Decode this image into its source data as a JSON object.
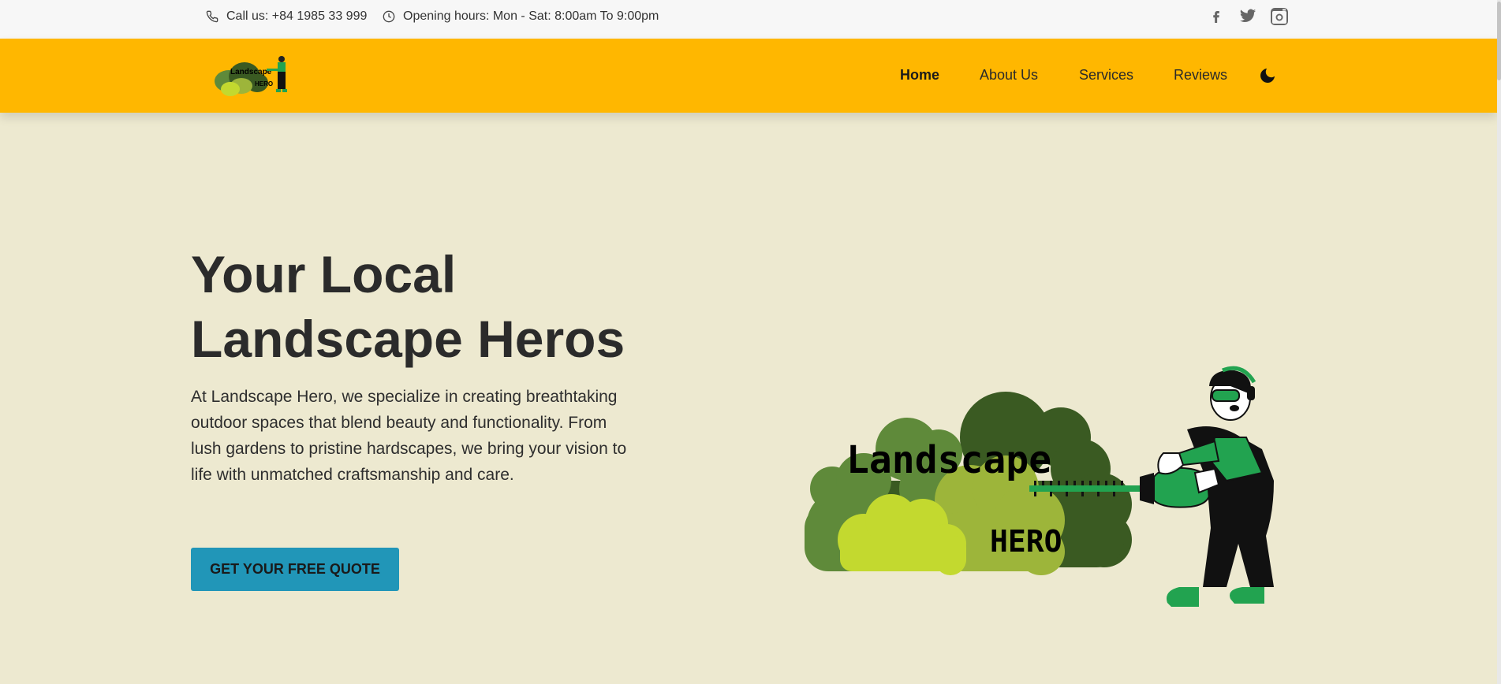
{
  "topbar": {
    "phone_text": "Call us: +84 1985 33 999",
    "hours_text": "Opening hours: Mon - Sat: 8:00am To 9:00pm",
    "social": [
      "facebook-icon",
      "twitter-icon",
      "instagram-icon"
    ]
  },
  "brand": {
    "logo_line1": "Landscape",
    "logo_line2": "HERO"
  },
  "nav": {
    "home": "Home",
    "about": "About Us",
    "services": "Services",
    "reviews": "Reviews",
    "theme_icon": "moon-icon"
  },
  "hero": {
    "title_line1": "Your Local",
    "title_line2": "Landscape Heros",
    "description": "At Landscape Hero, we specialize in creating breathtaking outdoor spaces that blend beauty and functionality. From lush gardens to pristine hardscapes, we bring your vision to life with unmatched craftsmanship and care.",
    "cta_label": "GET YOUR FREE QUOTE",
    "illustration_word1": "Landscape",
    "illustration_word2": "HERO"
  },
  "colors": {
    "topbar_bg": "#f7f7f7",
    "nav_bg": "#ffb700",
    "page_bg": "#ede9d0",
    "cta_bg": "#2196b8",
    "bush_dark": "#3a5a22",
    "bush_mid": "#5f8a3a",
    "bush_light": "#9db53a",
    "bush_lime": "#c3d92f",
    "hero_green": "#22a350"
  }
}
